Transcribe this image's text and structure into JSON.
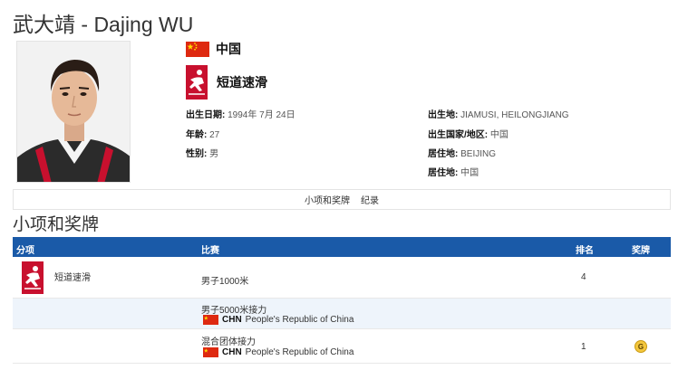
{
  "athlete": {
    "title": "武大靖 - Dajing WU",
    "country": "中国",
    "sport": "短道速滑"
  },
  "info_left": [
    {
      "label": "出生日期:",
      "value": " 1994年 7月 24日"
    },
    {
      "label": "年龄:",
      "value": " 27"
    },
    {
      "label": "性别:",
      "value": " 男"
    }
  ],
  "info_right": [
    {
      "label": "出生地:",
      "value": " JIAMUSI, HEILONGJIANG"
    },
    {
      "label": "出生国家/地区:",
      "value": " 中国"
    },
    {
      "label": "居住地:",
      "value": " BEIJING"
    },
    {
      "label": "居住地:",
      "value": " 中国"
    }
  ],
  "tabs": [
    "小项和奖牌",
    "纪录"
  ],
  "section_title": "小项和奖牌",
  "table": {
    "headers": [
      "分项",
      "比赛",
      "排名",
      "奖牌"
    ],
    "discipline": "短道速滑",
    "rows": [
      {
        "event": "男子1000米",
        "rank": "4",
        "medal": ""
      },
      {
        "event": "男子5000米接力",
        "noc_code": "CHN",
        "noc_name": "People's Republic of China",
        "rank": "",
        "medal": ""
      },
      {
        "event": "混合团体接力",
        "noc_code": "CHN",
        "noc_name": "People's Republic of China",
        "rank": "1",
        "medal": "G"
      }
    ]
  },
  "colors": {
    "header_bg": "#1a5aa8",
    "flag_red": "#de2910",
    "sport_red": "#c8102e",
    "gold": "#f3c63c"
  },
  "icons": {
    "flag": "china-flag-icon",
    "sport": "short-track-speed-skating-icon",
    "medal": "gold-medal-icon"
  }
}
